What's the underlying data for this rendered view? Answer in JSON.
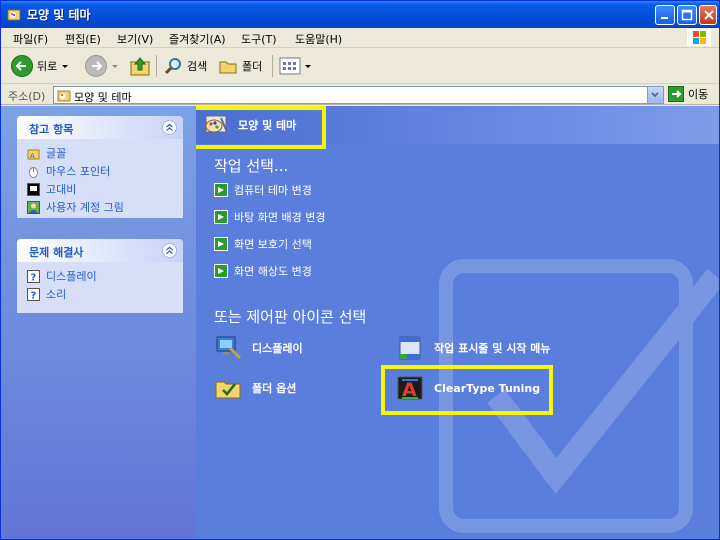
{
  "window": {
    "title": "모양 및 테마"
  },
  "menu": [
    "파일(F)",
    "편집(E)",
    "보기(V)",
    "즐겨찾기(A)",
    "도구(T)",
    "도움말(H)"
  ],
  "toolbar": {
    "back_label": "뒤로",
    "search_label": "검색",
    "folders_label": "폴더"
  },
  "address": {
    "label": "주소(D)",
    "value": "모양 및 테마",
    "go_label": "이동"
  },
  "sidebar": {
    "see_also": {
      "title": "참고 항목",
      "items": [
        "글꼴",
        "마우스 포인터",
        "고대비",
        "사용자 계정 그림"
      ]
    },
    "troubleshoot": {
      "title": "문제 해결사",
      "items": [
        "디스플레이",
        "소리"
      ]
    }
  },
  "main": {
    "header_title": "모양 및 테마",
    "pick_task": "작업 선택...",
    "tasks": [
      "컴퓨터 테마 변경",
      "바탕 화면 배경 변경",
      "화면 보호기 선택",
      "화면 해상도 변경"
    ],
    "pick_icon": "또는 제어판 아이콘 선택",
    "icons": [
      "디스플레이",
      "작업 표시줄 및 시작 메뉴",
      "폴더 옵션",
      "ClearType Tuning"
    ]
  },
  "colors": {
    "highlight": "#f5f50a",
    "content_bg": "#5a7edc",
    "link": "#215dc6"
  }
}
